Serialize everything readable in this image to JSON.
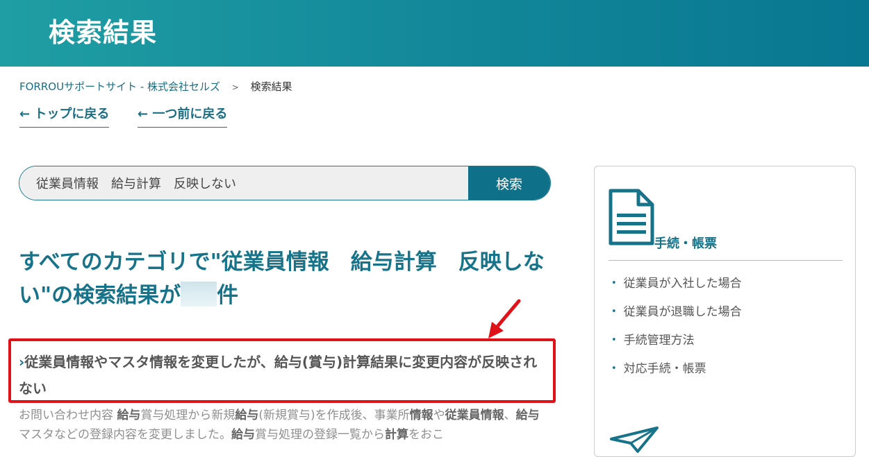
{
  "header": {
    "title": "検索結果"
  },
  "breadcrumb": {
    "home": "FORROUサポートサイト - 株式会社セルズ",
    "separator": ">",
    "current": "検索結果"
  },
  "nav": {
    "back_top": "← トップに戻る",
    "back_prev": "← 一つ前に戻る"
  },
  "search": {
    "query": "従業員情報　給与計算　反映しない",
    "button_label": "検索"
  },
  "results": {
    "heading_before": "すべてのカテゴリで\"従業員情報　給与計算　反映しない\"の検索結果が",
    "heading_after": "件",
    "items": [
      {
        "chevron": "›",
        "title": "従業員情報やマスタ情報を変更したが、給与(賞与)計算結果に変更内容が反映されない",
        "snippet": {
          "p1": "お問い合わせ内容 ",
          "k1": "給与",
          "p2": "賞与処理から新規",
          "k2": "給与",
          "p3": "(新規賞与)を作成後、事業所",
          "k3": "情報",
          "p4": "や",
          "k4": "従業員情報",
          "p5": "、",
          "k5": "給与",
          "p6": "マスタなどの登録内容を変更しました。",
          "k6": "給与",
          "p7": "賞与処理の登録一覧から",
          "k7": "計算",
          "p8": "をおこ"
        }
      }
    ]
  },
  "sidebar": {
    "category_title": "手続・帳票",
    "items": [
      {
        "label": "従業員が入社した場合"
      },
      {
        "label": "従業員が退職した場合"
      },
      {
        "label": "手続管理方法"
      },
      {
        "label": "対応手続・帳票"
      }
    ],
    "bullet": "•"
  },
  "colors": {
    "header_gradient_start": "#1f9ea3",
    "header_gradient_end": "#087791",
    "accent": "#16738a",
    "search_button": "#0e7189",
    "highlight_red": "#e01219"
  },
  "icons": [
    "document-icon",
    "paper-plane-icon",
    "red-arrow-annotation"
  ]
}
